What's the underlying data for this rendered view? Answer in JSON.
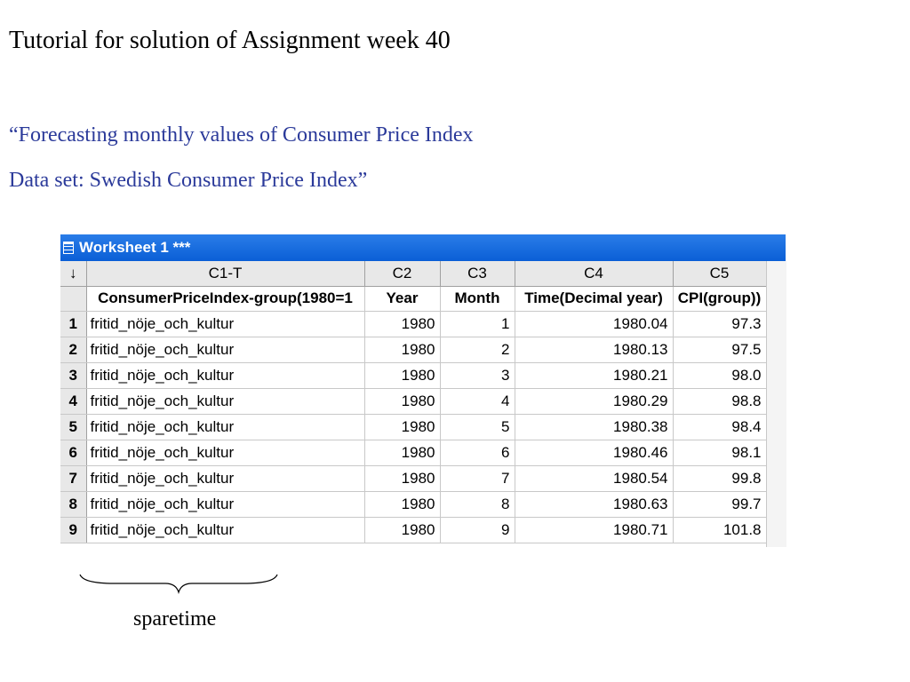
{
  "title": "Tutorial for solution of Assignment week 40",
  "subtitle_line1": "“Forecasting monthly values of Consumer Price Index",
  "subtitle_line2": "Data set:  Swedish Consumer Price Index”",
  "worksheet": {
    "title": "Worksheet 1 ***",
    "corner_symbol": "↓",
    "column_ids": [
      "C1-T",
      "C2",
      "C3",
      "C4",
      "C5"
    ],
    "column_names": [
      "ConsumerPriceIndex-group(1980=1",
      "Year",
      "Month",
      "Time(Decimal year)",
      "CPI(group))"
    ],
    "rows": [
      {
        "n": "1",
        "group": "fritid_nöje_och_kultur",
        "year": "1980",
        "month": "1",
        "time": "1980.04",
        "cpi": "97.3"
      },
      {
        "n": "2",
        "group": "fritid_nöje_och_kultur",
        "year": "1980",
        "month": "2",
        "time": "1980.13",
        "cpi": "97.5"
      },
      {
        "n": "3",
        "group": "fritid_nöje_och_kultur",
        "year": "1980",
        "month": "3",
        "time": "1980.21",
        "cpi": "98.0"
      },
      {
        "n": "4",
        "group": "fritid_nöje_och_kultur",
        "year": "1980",
        "month": "4",
        "time": "1980.29",
        "cpi": "98.8"
      },
      {
        "n": "5",
        "group": "fritid_nöje_och_kultur",
        "year": "1980",
        "month": "5",
        "time": "1980.38",
        "cpi": "98.4"
      },
      {
        "n": "6",
        "group": "fritid_nöje_och_kultur",
        "year": "1980",
        "month": "6",
        "time": "1980.46",
        "cpi": "98.1"
      },
      {
        "n": "7",
        "group": "fritid_nöje_och_kultur",
        "year": "1980",
        "month": "7",
        "time": "1980.54",
        "cpi": "99.8"
      },
      {
        "n": "8",
        "group": "fritid_nöje_och_kultur",
        "year": "1980",
        "month": "8",
        "time": "1980.63",
        "cpi": "99.7"
      },
      {
        "n": "9",
        "group": "fritid_nöje_och_kultur",
        "year": "1980",
        "month": "9",
        "time": "1980.71",
        "cpi": "101.8"
      }
    ]
  },
  "brace_label": "sparetime",
  "colors": {
    "subtitle": "#2b3a9a",
    "titlebar": "#0a5fd6",
    "header_bg": "#e8e8e8",
    "grid_line": "#c8c8c8"
  }
}
